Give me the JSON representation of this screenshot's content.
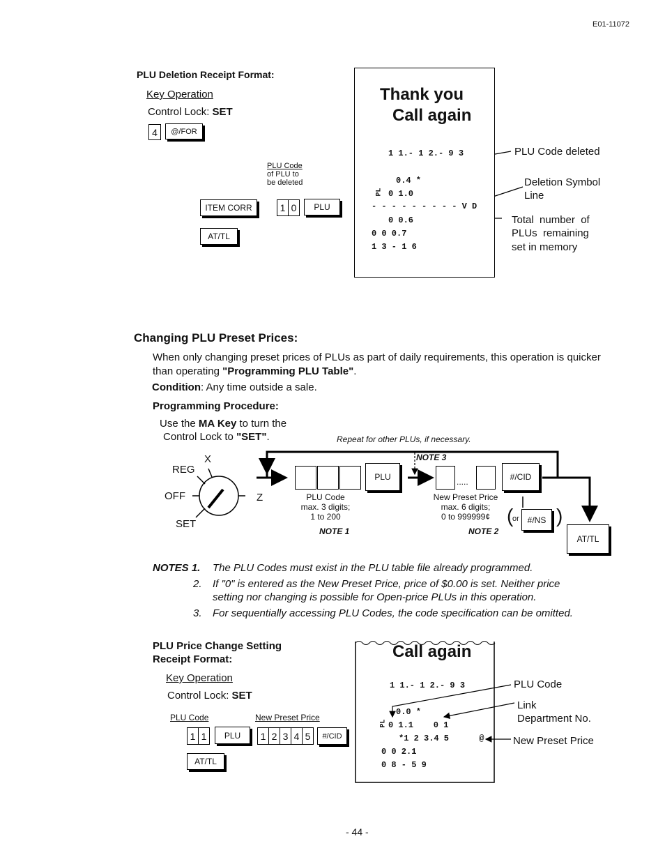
{
  "doc_id": "E01-11072",
  "deletion": {
    "title": "PLU Deletion Receipt Format:",
    "key_op": "Key Operation",
    "lock_label": "Control Lock: ",
    "lock_value": "SET",
    "keys": {
      "four": "4",
      "for": "@/FOR",
      "item_corr": "ITEM CORR",
      "d1": "1",
      "d0": "0",
      "plu": "PLU",
      "attl": "AT/TL"
    },
    "plu_note": [
      "PLU Code",
      "of PLU to",
      "be deleted"
    ],
    "receipt": {
      "l1": "Thank you",
      "l2": "Call again",
      "date": "1 1.- 1 2.- 9 3",
      "code": "0.4 *",
      "pl": "PL",
      "l_010": "0 1.0",
      "vd": "- - - - - - - - - V D",
      "l_006": "0 0.6",
      "l_0007": "0 0 0.7",
      "time": "1 3 - 1 6"
    },
    "ann": {
      "code": "PLU Code deleted",
      "del1": "Deletion Symbol",
      "del2": "Line",
      "tot1": "Total  number  of",
      "tot2": "PLUs  remaining",
      "tot3": "set in memory"
    }
  },
  "changing": {
    "title": "Changing PLU Preset Prices:",
    "para_a": "When only changing preset prices of PLUs as part of daily requirements, this operation is quicker than operating ",
    "para_b": "\"Programming PLU Table\"",
    "para_c": ".",
    "cond_label": "Condition",
    "cond_text": ": Any time outside a sale.",
    "proc": "Programming Procedure:",
    "use1a": "Use the ",
    "use1b": "MA Key",
    "use1c": " to turn the",
    "use2a": "Control Lock to ",
    "use2b": "\"SET\"",
    "use2c": ".",
    "repeat": "Repeat for other PLUs, if necessary.",
    "lock": {
      "x": "X",
      "reg": "REG",
      "off": "OFF",
      "z": "Z",
      "set": "SET"
    },
    "plu_key": "PLU",
    "cid_key": "#/CID",
    "ns_key": "#/NS",
    "or": "or",
    "attl_key": "AT/TL",
    "dots": ".....",
    "plu_code": [
      "PLU Code",
      "max. 3 digits;",
      "1 to 200"
    ],
    "note1": "NOTE 1",
    "price": [
      "New Preset Price",
      "max. 6 digits;",
      "0 to 999999¢"
    ],
    "note2": "NOTE 2",
    "note3": "NOTE 3"
  },
  "notes": {
    "label": "NOTES 1.",
    "n1": "The PLU Codes must exist in the PLU table file already programmed.",
    "n2num": "2.",
    "n2a": "If \"0\" is entered as the New Preset Price, price of $0.00 is set.  Neither price",
    "n2b": "setting nor changing is possible for Open-price PLUs in this operation.",
    "n3num": "3.",
    "n3": "For sequentially accessing PLU Codes, the code specification can be omitted."
  },
  "change": {
    "title1": "PLU Price Change Setting",
    "title2": "Receipt Format:",
    "key_op": "Key Operation",
    "lock_label": "Control Lock: ",
    "lock_value": "SET",
    "plu_code": "PLU Code",
    "new_price": "New Preset Price",
    "keys": {
      "a": "1",
      "b": "1",
      "plu": "PLU",
      "p1": "1",
      "p2": "2",
      "p3": "3",
      "p4": "4",
      "p5": "5",
      "cid": "#/CID",
      "attl": "AT/TL"
    },
    "receipt": {
      "l1": "Call again",
      "date": "1 1.- 1 2.- 9 3",
      "code": "0.0 *",
      "pl": "PL",
      "l2": "0 1.1    0 1",
      "price": "*1 2 3.4 5      @",
      "l3": "0 0 2.1",
      "time": "0 8 - 5 9"
    },
    "ann": {
      "code": "PLU Code",
      "link1": "Link",
      "link2": "Department No.",
      "price": "New Preset Price"
    }
  },
  "page_number": "- 44 -"
}
